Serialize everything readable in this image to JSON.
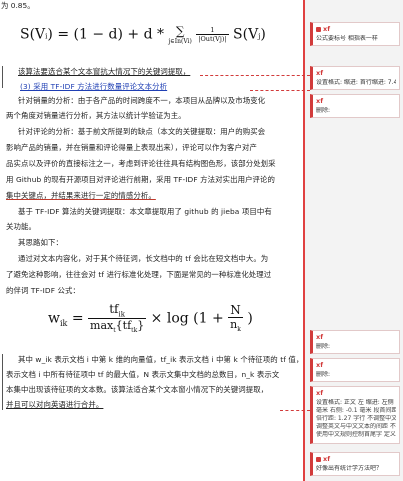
{
  "document": {
    "top_fragment": "为 0.85。",
    "formula1": {
      "lhs": "S(V",
      "lhs_sub": "i",
      "lhs_end": ") = (1 − d) + d *",
      "sum": "∑",
      "sum_sub": "j∈In(V",
      "sum_sub_i": "i",
      "sum_sub_end": ")",
      "frac_num": "1",
      "frac_den": "|Out(V",
      "frac_den_sub": "j",
      "frac_den_end": ")|",
      "rhs": "S(V",
      "rhs_sub": "j",
      "rhs_end": ")"
    },
    "lines": [
      "该算法要选合某个文本窗抗大情况下的关键词提取，",
      "(3) 采用 TF-IDF 方法进行数量评论文本分析",
      "针对销量的分析：由于各产品的时间跨度不一，本项目从品牌以及市场变化",
      "两个角度对销量进行分析，其方法以统计学验证为主。",
      "针对评论的分析：基于前文所提到的缺点（本文的关键提取：用户的购买会",
      "影响产品的销量，并在销量和评论得量上表现出来），评论可以作为客户对产",
      "品实点以及评价的直接标注之一，考虑到评论往往具有结构图色形，该部分处划采",
      "用 Github 的现有开源项目对评论进行前期，采用 TF-IDF 方法对实出用户评论的",
      "集中关键点，并结果来进行一定的情感分析。",
      "基于 TF-IDF 算法的关键词提取：本文章提取用了 github 的 jieba 项目中有",
      "关功能。",
      "其思路如下：",
      "通过对文本内容化，对于其个待征词，长文档中的 tf 会比在短文档中大。为",
      "了避免这种影响，往往会对 tf 进行标准化处理，下面是常见的一种标准化处理过",
      "的伴词 TF-IDF 公式："
    ],
    "formula2": {
      "lhs": "w",
      "lhs_sub": "ik",
      "eq": " = ",
      "frac_num": "tf",
      "frac_num_sub": "ik",
      "frac_den": "max",
      "frac_den_sub": "t",
      "frac_den_end": "{tf",
      "frac_den_sub2": "tk",
      "frac_den_close": "}",
      "times": " × log",
      "paren_open": "(1 + ",
      "n_num": "N",
      "n_den": "n",
      "n_den_sub": "k",
      "paren_close": ")"
    },
    "after_lines": [
      "其中 w_ik 表示文档 i 中第 k 维的向量值，tf_ik 表示文档 i 中第 k 个待征项的 tf 值，max",
      "表示文档 i 中所有待征项中 tf 的最大值，N 表示文集中文档的总数目，n_k 表示文",
      "本集中出现该待征项的文本数。该算法适合某个文本窗小情况下的关键词提取，",
      "并且可以对向英语进行合并。"
    ]
  },
  "comments": [
    {
      "author": "xf",
      "text": "公式要标号  相指表一样"
    },
    {
      "author": "xf",
      "text": "设置格式: 缩进: 首行缩进: 7.4  毫米"
    },
    {
      "author": "xf",
      "text": "删除:"
    },
    {
      "author": "xf",
      "text": "删除:"
    },
    {
      "author": "xf",
      "text": "删除:"
    },
    {
      "author": "xf",
      "text": "设置格式: 正文  左  缩进: 左侧 7",
      "details": [
        "毫米  右侧: -0.1  毫米  段首间距: 段",
        "倍行距: 1.27 字行  不调整中文与单",
        "调整英文与中文文本的间距  不允许",
        "使用中文规则控制首尾字  定义网格"
      ]
    },
    {
      "author": "xf",
      "text": "好像出有统计学方法吧？"
    }
  ],
  "colors": {
    "accent": "#d23b3b",
    "link": "#1f3fb4",
    "sidebar": "#f3f3f3"
  }
}
